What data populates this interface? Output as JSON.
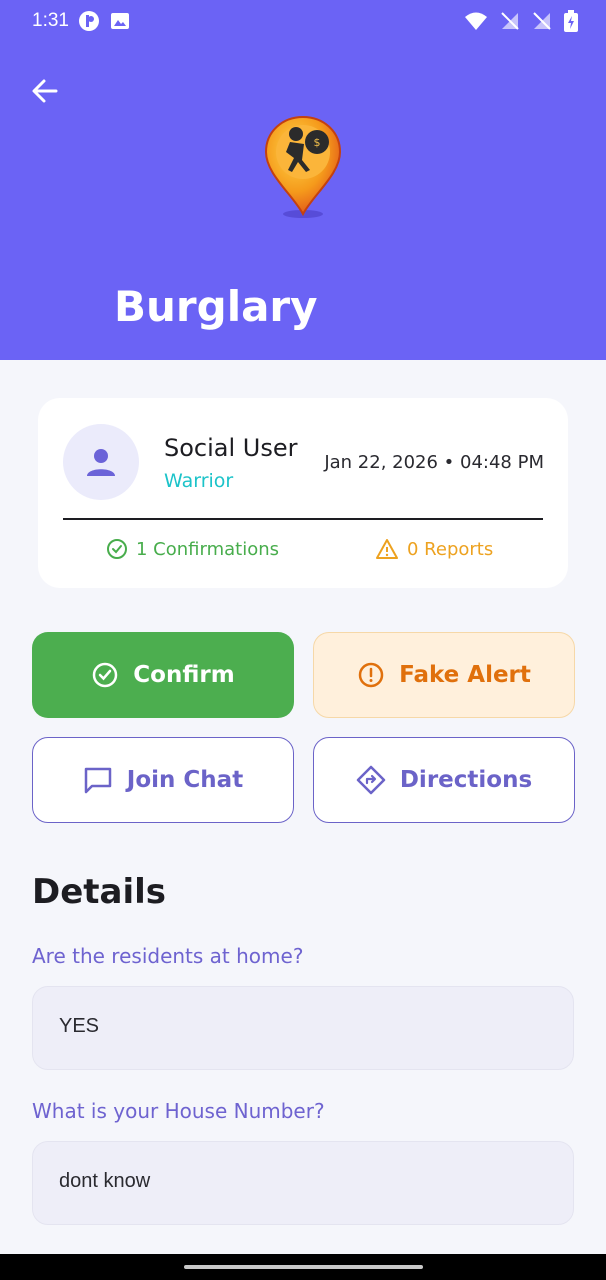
{
  "status_bar": {
    "time": "1:31"
  },
  "header": {
    "title": "Burglary"
  },
  "user_card": {
    "name": "Social User",
    "rank": "Warrior",
    "timestamp": "Jan 22, 2026 • 04:48 PM",
    "confirmations": "1 Confirmations",
    "reports": "0 Reports"
  },
  "actions": {
    "confirm": "Confirm",
    "fake_alert": "Fake Alert",
    "join_chat": "Join Chat",
    "directions": "Directions"
  },
  "details": {
    "title": "Details",
    "items": [
      {
        "question": "Are the residents at home?",
        "answer": "YES"
      },
      {
        "question": "What is your House Number?",
        "answer": "dont know"
      }
    ]
  },
  "colors": {
    "header": "#6b63f5",
    "confirm": "#4cae4f",
    "fake_alert": "#e0700c",
    "accent": "#6b63c8",
    "rank": "#1cc3c9"
  }
}
